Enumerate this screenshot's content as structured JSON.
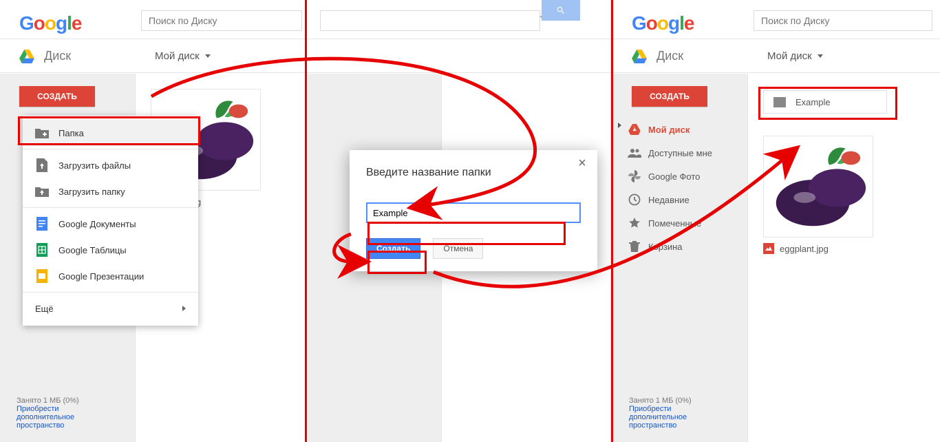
{
  "p1": {
    "searchPlaceholder": "Поиск по Диску",
    "diskLabel": "Диск",
    "breadcrumb": "Мой диск",
    "createBtn": "СОЗДАТЬ",
    "menu": {
      "folder": "Папка",
      "uploadFiles": "Загрузить файлы",
      "uploadFolder": "Загрузить папку",
      "docs": "Google Документы",
      "sheets": "Google Таблицы",
      "slides": "Google Презентации",
      "more": "Ещё"
    },
    "thumbCaption": "plant.jpg",
    "storageLine": "Занято 1 МБ (0%)",
    "storageLink1": "Приобрести",
    "storageLink2": "дополнительное",
    "storageLink3": "пространство"
  },
  "dialog": {
    "title": "Введите название папки",
    "value": "Example",
    "create": "Создать",
    "cancel": "Отмена"
  },
  "p3": {
    "searchPlaceholder": "Поиск по Диску",
    "diskLabel": "Диск",
    "breadcrumb": "Мой диск",
    "createBtn": "СОЗДАТЬ",
    "nav": {
      "myDrive": "Мой диск",
      "shared": "Доступные мне",
      "photos": "Google Фото",
      "recent": "Недавние",
      "starred": "Помеченные",
      "trash": "Корзина"
    },
    "folderName": "Example",
    "thumbCaption": "eggplant.jpg",
    "storageLine": "Занято 1 МБ (0%)",
    "storageLink1": "Приобрести",
    "storageLink2": "дополнительное",
    "storageLink3": "пространство"
  }
}
